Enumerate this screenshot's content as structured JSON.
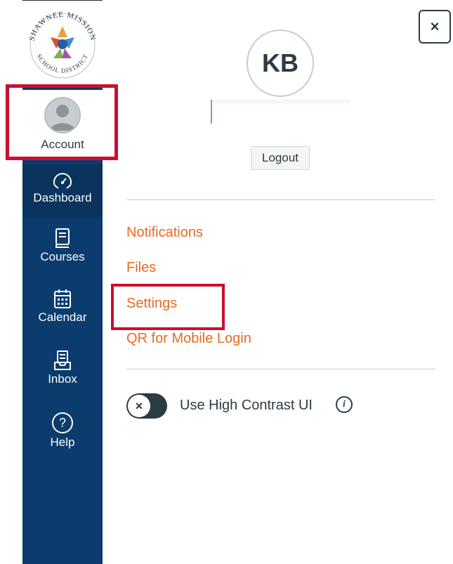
{
  "logo": {
    "top_text": "SHAWNEE MISSION",
    "bottom_text": "SCHOOL DISTRICT",
    "icon": "district-logo-star"
  },
  "global_nav": {
    "account": {
      "label": "Account",
      "icon": "user-avatar-icon"
    },
    "dashboard": {
      "label": "Dashboard",
      "icon": "dashboard-gauge-icon"
    },
    "courses": {
      "label": "Courses",
      "icon": "book-icon"
    },
    "calendar": {
      "label": "Calendar",
      "icon": "calendar-icon"
    },
    "inbox": {
      "label": "Inbox",
      "icon": "inbox-tray-icon"
    },
    "help": {
      "label": "Help",
      "icon": "question-circle-icon"
    }
  },
  "tray": {
    "close_label": "×",
    "avatar_initials": "KB",
    "logout_label": "Logout",
    "links": [
      "Notifications",
      "Files",
      "Settings",
      "QR for Mobile Login"
    ],
    "high_contrast": {
      "label": "Use High Contrast UI",
      "enabled": false,
      "knob": "×"
    },
    "info_icon": "i"
  },
  "colors": {
    "nav_bg": "#0c3c6e",
    "link": "#e66b21",
    "highlight": "#c8102e",
    "text": "#2d3b45"
  }
}
